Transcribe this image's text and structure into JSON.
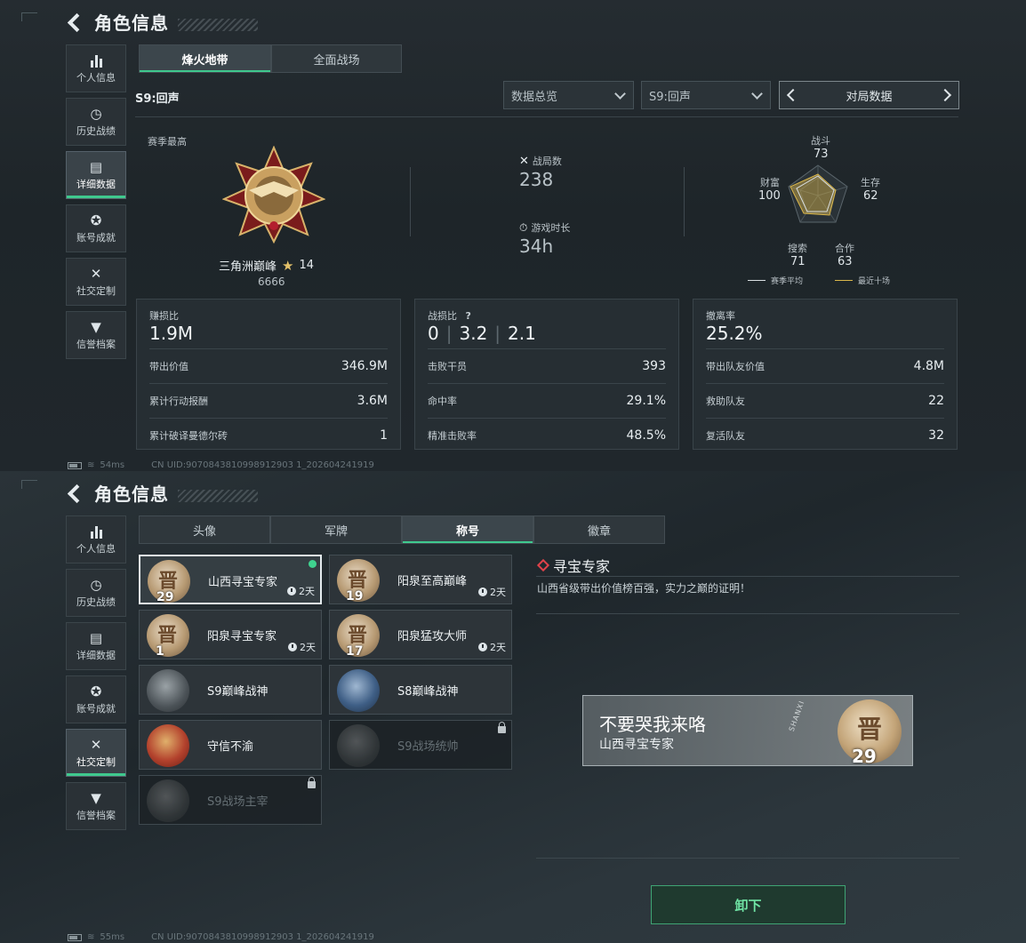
{
  "screen1": {
    "header": {
      "title": "角色信息"
    },
    "nav": [
      {
        "label": "个人信息",
        "icon": "bar-chart-icon",
        "active": false
      },
      {
        "label": "历史战绩",
        "icon": "clock-icon",
        "active": false
      },
      {
        "label": "详细数据",
        "icon": "folder-icon",
        "active": true
      },
      {
        "label": "账号成就",
        "icon": "trophy-icon",
        "active": false
      },
      {
        "label": "社交定制",
        "icon": "tools-icon",
        "active": false
      },
      {
        "label": "信誉档案",
        "icon": "badge-icon",
        "active": false
      }
    ],
    "tabs": [
      {
        "label": "烽火地带",
        "active": true
      },
      {
        "label": "全面战场",
        "active": false
      }
    ],
    "season_label": "S9:回声",
    "filters": {
      "overview": "数据总览",
      "season": "S9:回声",
      "pager": "对局数据"
    },
    "season_best": {
      "label": "赛季最高",
      "rank_name": "三角洲巅峰",
      "stars": "14",
      "score": "6666"
    },
    "battles": {
      "label": "战局数",
      "value": "238"
    },
    "playtime": {
      "label": "游戏时长",
      "value": "34h"
    },
    "radar": {
      "labels": {
        "combat": "战斗",
        "survival": "生存",
        "coop": "合作",
        "search": "搜索",
        "wealth": "财富"
      },
      "values": {
        "combat": "73",
        "survival": "62",
        "coop": "63",
        "search": "71",
        "wealth": "100"
      },
      "legend": {
        "season_avg": "赛季平均",
        "recent": "最近十场"
      },
      "colors": {
        "season_avg": "#d9dfe2",
        "recent": "#d9b64b"
      }
    },
    "cards": [
      {
        "label": "赚损比",
        "value": "1.9M",
        "rows": [
          {
            "k": "带出价值",
            "v": "346.9M"
          },
          {
            "k": "累计行动报酬",
            "v": "3.6M"
          },
          {
            "k": "累计破译曼德尔砖",
            "v": "1"
          }
        ]
      },
      {
        "label": "战损比",
        "value_parts": [
          "0",
          "3.2",
          "2.1"
        ],
        "help": "?",
        "rows": [
          {
            "k": "击败干员",
            "v": "393"
          },
          {
            "k": "命中率",
            "v": "29.1%"
          },
          {
            "k": "精准击败率",
            "v": "48.5%"
          }
        ]
      },
      {
        "label": "撤离率",
        "value": "25.2%",
        "rows": [
          {
            "k": "带出队友价值",
            "v": "4.8M"
          },
          {
            "k": "救助队友",
            "v": "22"
          },
          {
            "k": "复活队友",
            "v": "32"
          }
        ]
      }
    ],
    "status": {
      "ping": "54ms",
      "uid": "CN UID:9070843810998912903 1_202604241919"
    }
  },
  "screen2": {
    "header": {
      "title": "角色信息"
    },
    "nav": [
      {
        "label": "个人信息",
        "active": false
      },
      {
        "label": "历史战绩",
        "active": false
      },
      {
        "label": "详细数据",
        "active": false
      },
      {
        "label": "账号成就",
        "active": false
      },
      {
        "label": "社交定制",
        "active": true
      },
      {
        "label": "信誉档案",
        "active": false
      }
    ],
    "tabs": [
      {
        "label": "头像",
        "active": false
      },
      {
        "label": "军牌",
        "active": false
      },
      {
        "label": "称号",
        "active": true
      },
      {
        "label": "徽章",
        "active": false
      }
    ],
    "titles": [
      {
        "name": "山西寻宝专家",
        "num": "29",
        "time": "2天",
        "selected": true,
        "equipped": true,
        "style": "gold",
        "char": "晋"
      },
      {
        "name": "阳泉至高巅峰",
        "num": "19",
        "time": "2天",
        "style": "gold",
        "char": "晋"
      },
      {
        "name": "阳泉寻宝专家",
        "num": "1",
        "time": "2天",
        "style": "gold",
        "char": "晋"
      },
      {
        "name": "阳泉猛攻大师",
        "num": "17",
        "time": "2天",
        "style": "gold",
        "char": "晋"
      },
      {
        "name": "S9巅峰战神",
        "style": "dark"
      },
      {
        "name": "S8巅峰战神",
        "style": "blue"
      },
      {
        "name": "守信不渝",
        "style": "red"
      },
      {
        "name": "S9战场统帅",
        "style": "grey",
        "locked": true
      },
      {
        "name": "S9战场主宰",
        "style": "grey",
        "locked": true
      }
    ],
    "detail": {
      "title": "寻宝专家",
      "desc": "山西省级带出价值榜百强，实力之巅的证明！",
      "nameplate_player": "不要哭我来咯",
      "nameplate_title": "山西寻宝专家",
      "nameplate_num": "29",
      "nameplate_char": "晋",
      "nameplate_stamp": "SHANXI"
    },
    "unequip_label": "卸下",
    "status": {
      "ping": "55ms",
      "uid": "CN UID:9070843810998912903 1_202604241919"
    }
  }
}
